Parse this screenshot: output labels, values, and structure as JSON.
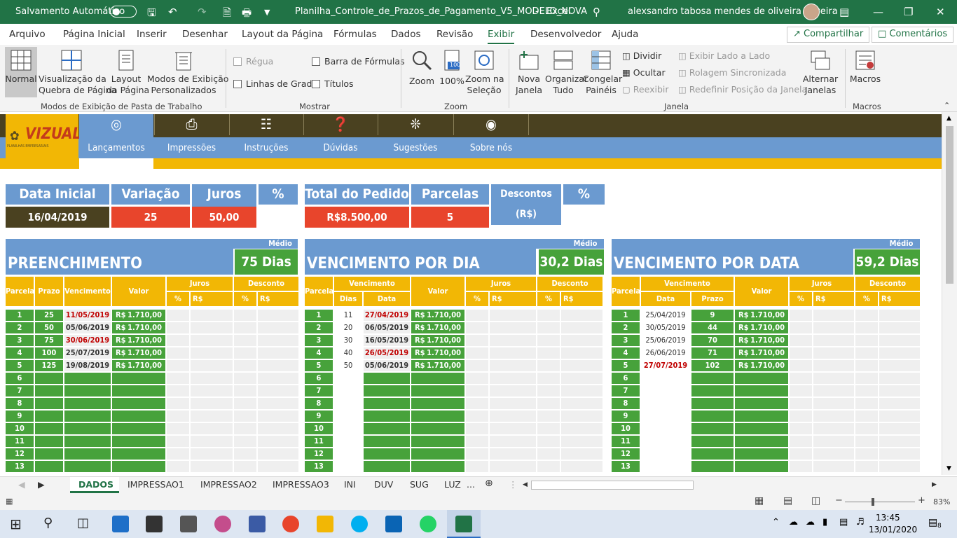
{
  "titlebar": {
    "autosave": "Salvamento Automático",
    "filename": "Planilha_Controle_de_Prazos_de_Pagamento_V5_MODELO_NOVA",
    "separator": "-",
    "app": "Excel",
    "user": "alexsandro tabosa mendes de oliveira oliveira"
  },
  "menu": {
    "items": [
      "Arquivo",
      "Página Inicial",
      "Inserir",
      "Desenhar",
      "Layout da Página",
      "Fórmulas",
      "Dados",
      "Revisão",
      "Exibir",
      "Desenvolvedor",
      "Ajuda"
    ],
    "share": "Compartilhar",
    "comments": "Comentários"
  },
  "ribbon": {
    "views": {
      "normal": "Normal",
      "pagebreak1": "Visualização da",
      "pagebreak2": "Quebra de Página",
      "layout1": "Layout",
      "layout2": "da Página",
      "custom1": "Modos de Exibição",
      "custom2": "Personalizados",
      "group": "Modos de Exibição de Pasta de Trabalho"
    },
    "show": {
      "ruler": "Régua",
      "formulabar": "Barra de Fórmulas",
      "gridlines": "Linhas de Grade",
      "headings": "Títulos",
      "group": "Mostrar"
    },
    "zoom": {
      "zoom": "Zoom",
      "p100": "100%",
      "zoomsel1": "Zoom na",
      "zoomsel2": "Seleção",
      "group": "Zoom",
      "badge": "100"
    },
    "window": {
      "new1": "Nova",
      "new2": "Janela",
      "arrange1": "Organizar",
      "arrange2": "Tudo",
      "freeze1": "Congelar",
      "freeze2": "Painéis",
      "split": "Dividir",
      "hide": "Ocultar",
      "unhide": "Reexibir",
      "sidebyside": "Exibir Lado a Lado",
      "syncscroll": "Rolagem Sincronizada",
      "resetpos": "Redefinir Posição da Janela",
      "switch1": "Alternar",
      "switch2": "Janelas",
      "group": "Janela"
    },
    "macros": {
      "label": "Macros",
      "group": "Macros"
    }
  },
  "nav": {
    "logo": "VIZUAL",
    "logo_sub": "PLANILHAS EMPRESARIAIS",
    "items": [
      "Lançamentos",
      "Impressões",
      "Instruções",
      "Dúvidas",
      "Sugestões",
      "Sobre nós"
    ]
  },
  "summary": {
    "headers": [
      "Data Inicial",
      "Variação",
      "Juros (R$)",
      "%",
      "Total do Pedido",
      "Parcelas",
      "Descontos (R$)",
      "%"
    ],
    "values": [
      "16/04/2019",
      "25",
      "50,00",
      "",
      "R$8.500,00",
      "5",
      "",
      ""
    ]
  },
  "sections": {
    "auto": {
      "title": "PREENCHIMENTO AUTOMÁTICO",
      "medio_label": "Médio",
      "medio": "75 Dias",
      "cols": [
        "Parcela",
        "Prazo",
        "Vencimento",
        "Valor",
        "Juros",
        "Desconto",
        "%",
        "R$",
        "%",
        "R$"
      ]
    },
    "dia": {
      "title": "VENCIMENTO POR DIA",
      "medio_label": "Médio",
      "medio": "30,2 Dias",
      "cols": [
        "Parcela",
        "Vencimento",
        "Dias",
        "Data",
        "Valor",
        "Juros",
        "Desconto",
        "%",
        "R$",
        "%",
        "R$"
      ]
    },
    "data": {
      "title": "VENCIMENTO POR DATA",
      "medio_label": "Médio",
      "medio": "59,2 Dias",
      "cols": [
        "Parcela",
        "Vencimento",
        "Data",
        "Prazo",
        "Valor",
        "Juros",
        "Desconto",
        "%",
        "R$",
        "%",
        "R$"
      ]
    }
  },
  "rows_auto": [
    [
      "1",
      "25",
      "11/05/2019",
      "R$",
      "1.710,00"
    ],
    [
      "2",
      "50",
      "05/06/2019",
      "R$",
      "1.710,00"
    ],
    [
      "3",
      "75",
      "30/06/2019",
      "R$",
      "1.710,00"
    ],
    [
      "4",
      "100",
      "25/07/2019",
      "R$",
      "1.710,00"
    ],
    [
      "5",
      "125",
      "19/08/2019",
      "R$",
      "1.710,00"
    ]
  ],
  "rows_dia": [
    [
      "1",
      "11",
      "27/04/2019",
      "R$",
      "1.710,00"
    ],
    [
      "2",
      "20",
      "06/05/2019",
      "R$",
      "1.710,00"
    ],
    [
      "3",
      "30",
      "16/05/2019",
      "R$",
      "1.710,00"
    ],
    [
      "4",
      "40",
      "26/05/2019",
      "R$",
      "1.710,00"
    ],
    [
      "5",
      "50",
      "05/06/2019",
      "R$",
      "1.710,00"
    ]
  ],
  "rows_data": [
    [
      "1",
      "25/04/2019",
      "9",
      "R$",
      "1.710,00"
    ],
    [
      "2",
      "30/05/2019",
      "44",
      "R$",
      "1.710,00"
    ],
    [
      "3",
      "25/06/2019",
      "70",
      "R$",
      "1.710,00"
    ],
    [
      "4",
      "26/06/2019",
      "71",
      "R$",
      "1.710,00"
    ],
    [
      "5",
      "27/07/2019",
      "102",
      "R$",
      "1.710,00"
    ]
  ],
  "row_numbers": [
    "6",
    "7",
    "8",
    "9",
    "10",
    "11",
    "12",
    "13"
  ],
  "sheettabs": [
    "DADOS",
    "IMPRESSAO1",
    "IMPRESSAO2",
    "IMPRESSAO3",
    "INI",
    "DUV",
    "SUG",
    "LUZ",
    "..."
  ],
  "status": {
    "zoom": "83%",
    "minus": "−",
    "plus": "+"
  },
  "taskbar": {
    "time": "13:45",
    "date": "13/01/2020",
    "notif": "8"
  },
  "colors": {
    "excel_green": "#217346",
    "header_blue": "#6b9ad0",
    "accent_yellow": "#f2b705",
    "value_red": "#e8452c",
    "cell_green": "#47a23b",
    "dark_nav": "#4a4120"
  }
}
